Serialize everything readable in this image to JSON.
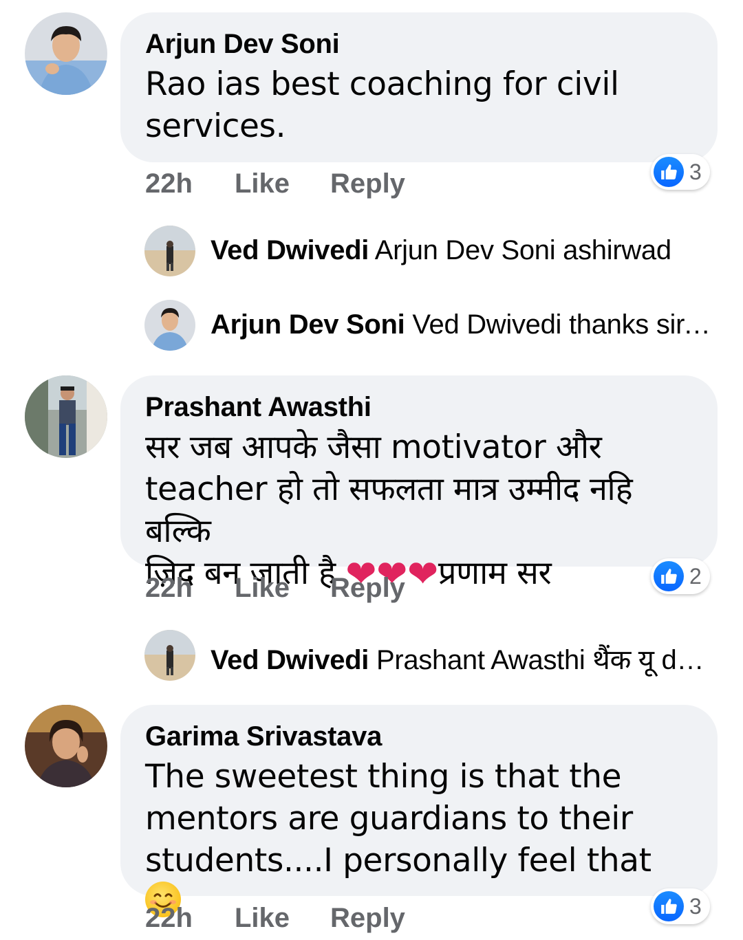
{
  "colors": {
    "bubble": "#f0f2f5",
    "action_text": "#65676b",
    "like_blue": "#0866ff",
    "heart": "#e0245e"
  },
  "comments": [
    {
      "author": "Arjun Dev Soni",
      "text_lines": [
        "Rao ias best coaching for civil",
        "services."
      ],
      "time": "22h",
      "like": "Like",
      "reply": "Reply",
      "reaction_icon": "thumbs-up-icon",
      "reaction_count": "3"
    },
    {
      "author": "Prashant Awasthi",
      "text_lines": [
        "सर जब आपके जैसा motivator और",
        "teacher हो तो सफलता मात्र उम्मीद नहि बल्कि",
        "ज़िद बन जाती है "
      ],
      "text_suffix": "प्रणाम सर",
      "hearts": "❤❤❤",
      "time": "22h",
      "like": "Like",
      "reply": "Reply",
      "reaction_icon": "thumbs-up-icon",
      "reaction_count": "2"
    },
    {
      "author": "Garima Srivastava",
      "text_lines": [
        "The sweetest thing is that the",
        "mentors are guardians to their",
        "students....I personally feel that "
      ],
      "emoji_icon": "smiling-face-icon",
      "time": "22h",
      "like": "Like",
      "reply": "Reply",
      "reaction_icon": "thumbs-up-icon",
      "reaction_count": "3"
    }
  ],
  "replies": [
    {
      "author": "Ved Dwivedi",
      "text": "Arjun Dev Soni ashirwad"
    },
    {
      "author": "Arjun Dev Soni",
      "text": "Ved Dwivedi  thanks sir,..."
    },
    {
      "author": "Ved Dwivedi",
      "text": "Prashant Awasthi थैंक यू de..."
    }
  ]
}
